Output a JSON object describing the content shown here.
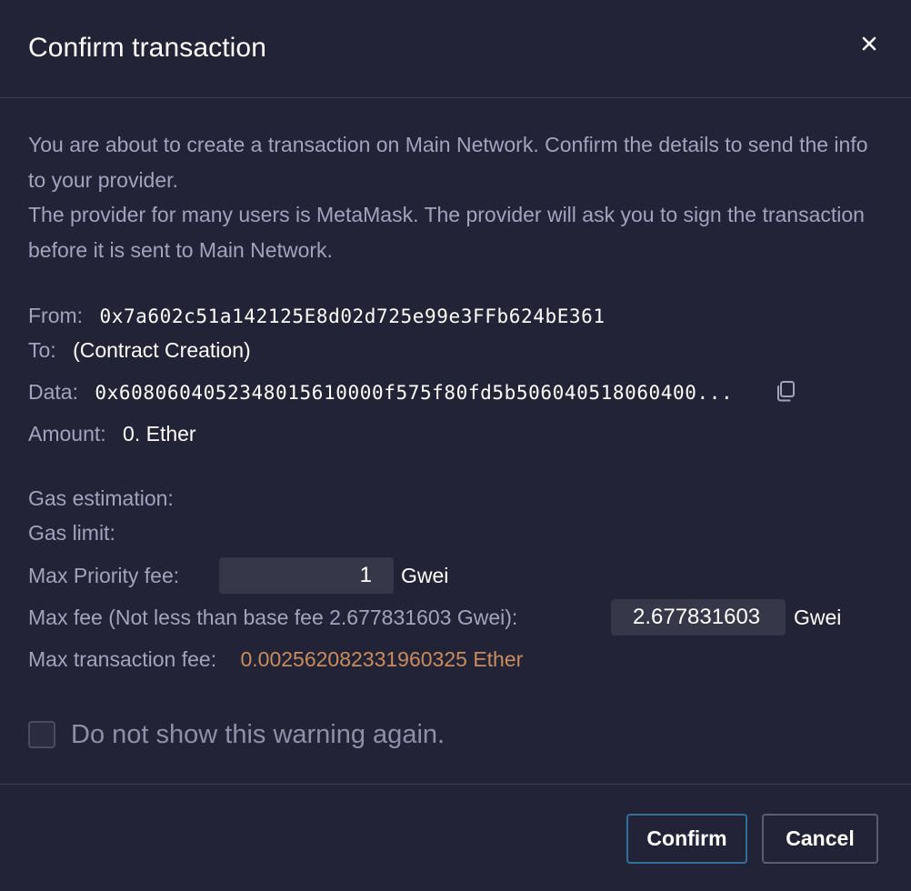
{
  "modal": {
    "title": "Confirm transaction",
    "close_icon": "close-icon"
  },
  "intro": {
    "line1": "You are about to create a transaction on Main Network. Confirm the details to send the info to your provider.",
    "line2": "The provider for many users is MetaMask. The provider will ask you to sign the transaction before it is sent to Main Network."
  },
  "details": {
    "from_label": "From:",
    "from_value": "0x7a602c51a142125E8d02d725e99e3FFb624bE361",
    "to_label": "To:",
    "to_value": "(Contract Creation)",
    "data_label": "Data:",
    "data_value": "0x6080604052348015610000f575f80fd5b506040518060400...",
    "copy_icon": "copy-icon",
    "amount_label": "Amount:",
    "amount_value": "0. Ether"
  },
  "gas": {
    "estimation_label": "Gas estimation:",
    "limit_label": "Gas limit:",
    "priority_label": "Max Priority fee:",
    "priority_value": "1",
    "priority_unit": "Gwei",
    "maxfee_label": "Max fee (Not less than base fee 2.677831603 Gwei):",
    "maxfee_value": "2.677831603",
    "maxfee_unit": "Gwei",
    "max_tx_label": "Max transaction fee:",
    "max_tx_value": "0.002562082331960325 Ether"
  },
  "warning": {
    "checked": false,
    "label": "Do not show this warning again."
  },
  "footer": {
    "confirm_label": "Confirm",
    "cancel_label": "Cancel"
  },
  "colors": {
    "background": "#222336",
    "accent_orange": "#c98c5c",
    "confirm_border": "#2f6f9a"
  }
}
